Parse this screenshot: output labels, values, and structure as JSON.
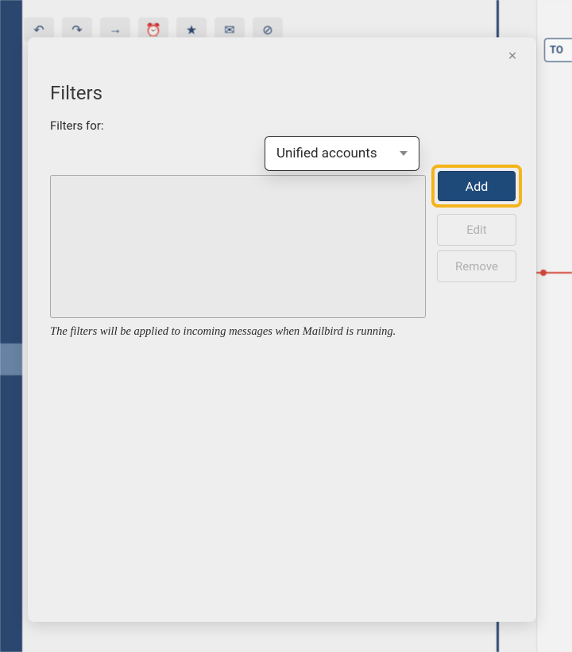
{
  "background": {
    "toolbar_icons": [
      "↶",
      "↷",
      "→",
      "⏰",
      "★",
      "✉",
      "⊘"
    ],
    "right_button": "TO"
  },
  "dialog": {
    "title": "Filters",
    "filters_for_label": "Filters for:",
    "account_select": {
      "selected": "Unified accounts"
    },
    "buttons": {
      "add": "Add",
      "edit": "Edit",
      "remove": "Remove"
    },
    "hint": "The filters will be applied to incoming messages when Mailbird is running."
  }
}
